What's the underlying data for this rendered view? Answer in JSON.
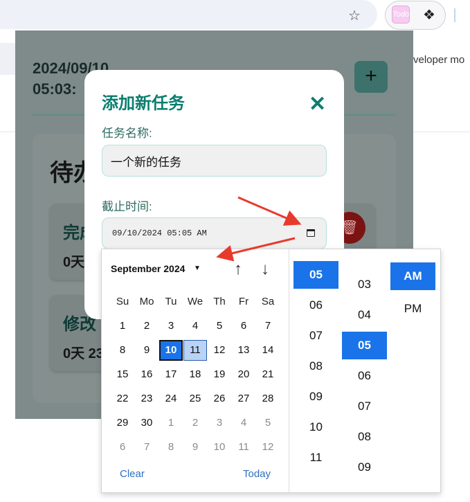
{
  "browser": {
    "bookmark_icon": "star-icon",
    "extension_badge": "Todo",
    "extensions_icon": "puzzle-icon",
    "side_text": "veloper mo"
  },
  "popup": {
    "date": "2024/09/10",
    "time": "05:03:",
    "add_icon": "+",
    "panel_title": "待办",
    "cards": [
      {
        "title": "完成",
        "sub": "0天"
      },
      {
        "title": "修改",
        "sub": "0天 23"
      }
    ],
    "delete_icon": "trash-icon"
  },
  "modal": {
    "title": "添加新任务",
    "close_icon": "✕",
    "name_label": "任务名称:",
    "name_value": "一个新的任务",
    "deadline_label": "截止时间:",
    "deadline_value": "09/10/2024 05:05 AM"
  },
  "picker": {
    "month_label": "September 2024",
    "weekdays": [
      "Su",
      "Mo",
      "Tu",
      "We",
      "Th",
      "Fr",
      "Sa"
    ],
    "days": [
      [
        "1",
        "2",
        "3",
        "4",
        "5",
        "6",
        "7"
      ],
      [
        "8",
        "9",
        "10",
        "11",
        "12",
        "13",
        "14"
      ],
      [
        "15",
        "16",
        "17",
        "18",
        "19",
        "20",
        "21"
      ],
      [
        "22",
        "23",
        "24",
        "25",
        "26",
        "27",
        "28"
      ],
      [
        "29",
        "30",
        "1",
        "2",
        "3",
        "4",
        "5"
      ],
      [
        "6",
        "7",
        "8",
        "9",
        "10",
        "11",
        "12"
      ]
    ],
    "selected_day": "10",
    "hover_day": "11",
    "clear_label": "Clear",
    "today_label": "Today",
    "hours": [
      "05",
      "06",
      "07",
      "08",
      "09",
      "10",
      "11"
    ],
    "selected_hour": "05",
    "minutes": [
      "03",
      "04",
      "05",
      "06",
      "07",
      "08",
      "09"
    ],
    "selected_minute": "05",
    "ampm": [
      "AM",
      "PM"
    ],
    "selected_ampm": "AM"
  },
  "colors": {
    "accent": "#0a7e6e",
    "selection": "#1a73e8",
    "annotation": "#e83a2c"
  }
}
